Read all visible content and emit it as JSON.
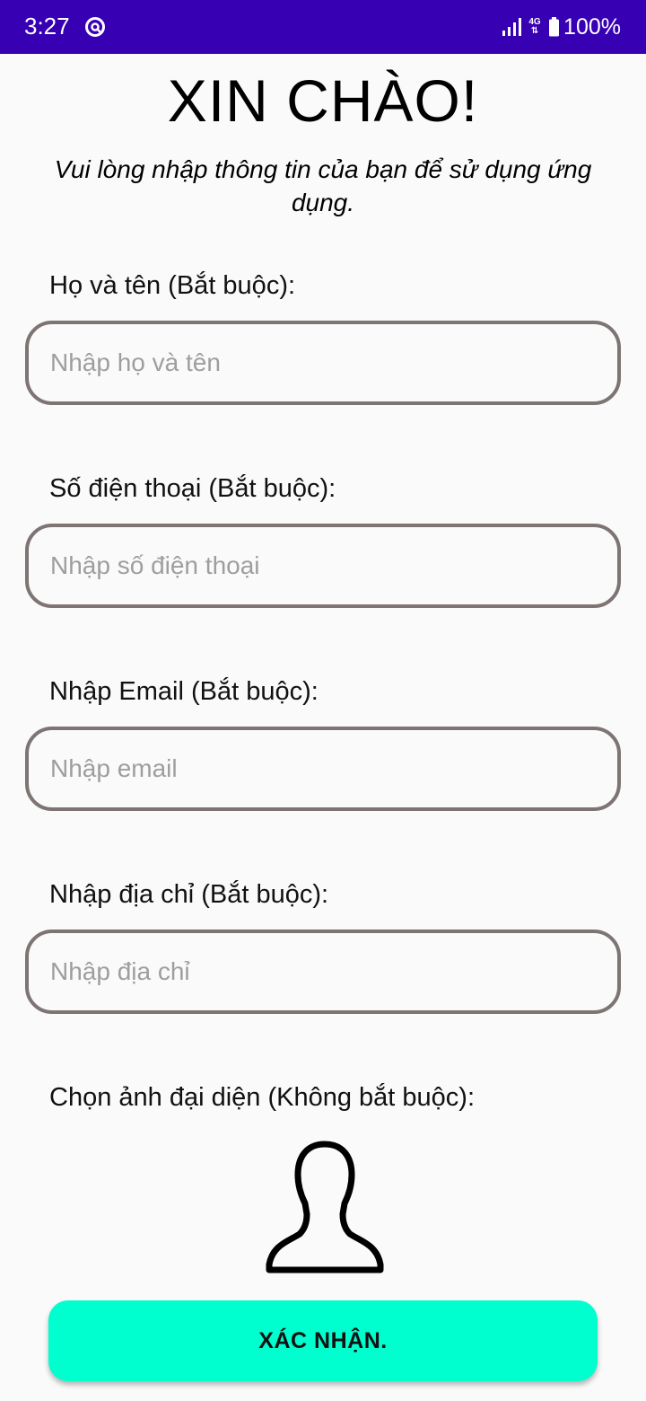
{
  "status_bar": {
    "time": "3:27",
    "network": "4G",
    "battery": "100%",
    "icons": [
      "app-notification-icon",
      "signal-icon",
      "network-4g-icon",
      "battery-icon"
    ],
    "background_color": "#3700B3"
  },
  "header": {
    "title": "XIN CHÀO!",
    "subtitle": "Vui lòng nhập thông tin của bạn để sử dụng ứng dụng."
  },
  "form": {
    "name": {
      "label": "Họ và tên (Bắt buộc):",
      "placeholder": "Nhập họ và tên",
      "value": ""
    },
    "phone": {
      "label": "Số điện thoại (Bắt buộc):",
      "placeholder": "Nhập số điện thoại",
      "value": ""
    },
    "email": {
      "label": "Nhập Email (Bắt buộc):",
      "placeholder": "Nhập email",
      "value": ""
    },
    "address": {
      "label": "Nhập địa chỉ (Bắt buộc):",
      "placeholder": "Nhập địa chỉ",
      "value": ""
    },
    "avatar": {
      "label": "Chọn ảnh đại diện (Không bắt buộc):",
      "icon": "person-avatar-icon"
    }
  },
  "confirm_button": {
    "label": "XÁC NHẬN.",
    "color": "#00FFCF"
  },
  "colors": {
    "input_border": "#7D7473",
    "placeholder": "#9E9E9E",
    "background": "#FAFAFA"
  }
}
